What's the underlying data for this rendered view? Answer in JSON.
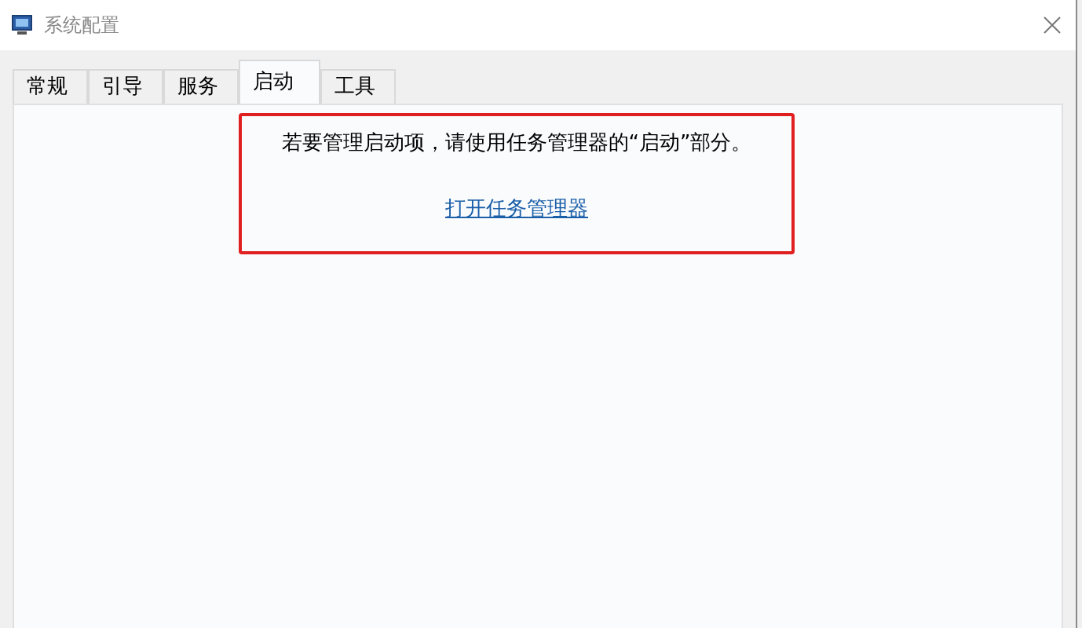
{
  "window": {
    "title": "系统配置"
  },
  "tabs": [
    {
      "label": "常规",
      "selected": false
    },
    {
      "label": "引导",
      "selected": false
    },
    {
      "label": "服务",
      "selected": false
    },
    {
      "label": "启动",
      "selected": true
    },
    {
      "label": "工具",
      "selected": false
    }
  ],
  "startup_panel": {
    "message": "若要管理启动项，请使用任务管理器的“启动”部分。",
    "link": "打开任务管理器"
  }
}
